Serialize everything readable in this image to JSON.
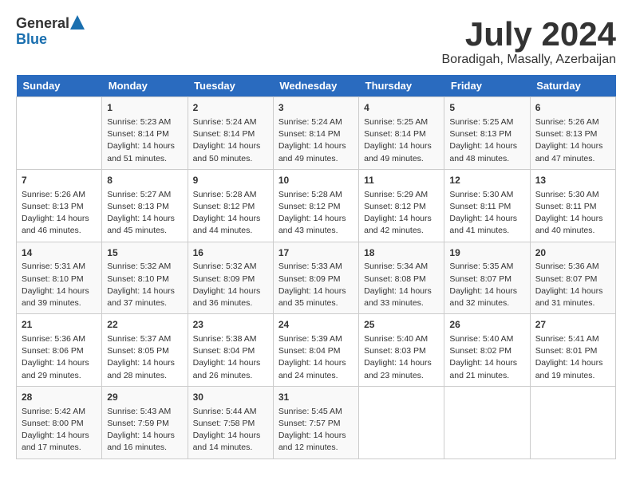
{
  "logo": {
    "general": "General",
    "blue": "Blue"
  },
  "title": "July 2024",
  "subtitle": "Boradigah, Masally, Azerbaijan",
  "days_of_week": [
    "Sunday",
    "Monday",
    "Tuesday",
    "Wednesday",
    "Thursday",
    "Friday",
    "Saturday"
  ],
  "weeks": [
    [
      {
        "day": "",
        "info": ""
      },
      {
        "day": "1",
        "info": "Sunrise: 5:23 AM\nSunset: 8:14 PM\nDaylight: 14 hours\nand 51 minutes."
      },
      {
        "day": "2",
        "info": "Sunrise: 5:24 AM\nSunset: 8:14 PM\nDaylight: 14 hours\nand 50 minutes."
      },
      {
        "day": "3",
        "info": "Sunrise: 5:24 AM\nSunset: 8:14 PM\nDaylight: 14 hours\nand 49 minutes."
      },
      {
        "day": "4",
        "info": "Sunrise: 5:25 AM\nSunset: 8:14 PM\nDaylight: 14 hours\nand 49 minutes."
      },
      {
        "day": "5",
        "info": "Sunrise: 5:25 AM\nSunset: 8:13 PM\nDaylight: 14 hours\nand 48 minutes."
      },
      {
        "day": "6",
        "info": "Sunrise: 5:26 AM\nSunset: 8:13 PM\nDaylight: 14 hours\nand 47 minutes."
      }
    ],
    [
      {
        "day": "7",
        "info": "Sunrise: 5:26 AM\nSunset: 8:13 PM\nDaylight: 14 hours\nand 46 minutes."
      },
      {
        "day": "8",
        "info": "Sunrise: 5:27 AM\nSunset: 8:13 PM\nDaylight: 14 hours\nand 45 minutes."
      },
      {
        "day": "9",
        "info": "Sunrise: 5:28 AM\nSunset: 8:12 PM\nDaylight: 14 hours\nand 44 minutes."
      },
      {
        "day": "10",
        "info": "Sunrise: 5:28 AM\nSunset: 8:12 PM\nDaylight: 14 hours\nand 43 minutes."
      },
      {
        "day": "11",
        "info": "Sunrise: 5:29 AM\nSunset: 8:12 PM\nDaylight: 14 hours\nand 42 minutes."
      },
      {
        "day": "12",
        "info": "Sunrise: 5:30 AM\nSunset: 8:11 PM\nDaylight: 14 hours\nand 41 minutes."
      },
      {
        "day": "13",
        "info": "Sunrise: 5:30 AM\nSunset: 8:11 PM\nDaylight: 14 hours\nand 40 minutes."
      }
    ],
    [
      {
        "day": "14",
        "info": "Sunrise: 5:31 AM\nSunset: 8:10 PM\nDaylight: 14 hours\nand 39 minutes."
      },
      {
        "day": "15",
        "info": "Sunrise: 5:32 AM\nSunset: 8:10 PM\nDaylight: 14 hours\nand 37 minutes."
      },
      {
        "day": "16",
        "info": "Sunrise: 5:32 AM\nSunset: 8:09 PM\nDaylight: 14 hours\nand 36 minutes."
      },
      {
        "day": "17",
        "info": "Sunrise: 5:33 AM\nSunset: 8:09 PM\nDaylight: 14 hours\nand 35 minutes."
      },
      {
        "day": "18",
        "info": "Sunrise: 5:34 AM\nSunset: 8:08 PM\nDaylight: 14 hours\nand 33 minutes."
      },
      {
        "day": "19",
        "info": "Sunrise: 5:35 AM\nSunset: 8:07 PM\nDaylight: 14 hours\nand 32 minutes."
      },
      {
        "day": "20",
        "info": "Sunrise: 5:36 AM\nSunset: 8:07 PM\nDaylight: 14 hours\nand 31 minutes."
      }
    ],
    [
      {
        "day": "21",
        "info": "Sunrise: 5:36 AM\nSunset: 8:06 PM\nDaylight: 14 hours\nand 29 minutes."
      },
      {
        "day": "22",
        "info": "Sunrise: 5:37 AM\nSunset: 8:05 PM\nDaylight: 14 hours\nand 28 minutes."
      },
      {
        "day": "23",
        "info": "Sunrise: 5:38 AM\nSunset: 8:04 PM\nDaylight: 14 hours\nand 26 minutes."
      },
      {
        "day": "24",
        "info": "Sunrise: 5:39 AM\nSunset: 8:04 PM\nDaylight: 14 hours\nand 24 minutes."
      },
      {
        "day": "25",
        "info": "Sunrise: 5:40 AM\nSunset: 8:03 PM\nDaylight: 14 hours\nand 23 minutes."
      },
      {
        "day": "26",
        "info": "Sunrise: 5:40 AM\nSunset: 8:02 PM\nDaylight: 14 hours\nand 21 minutes."
      },
      {
        "day": "27",
        "info": "Sunrise: 5:41 AM\nSunset: 8:01 PM\nDaylight: 14 hours\nand 19 minutes."
      }
    ],
    [
      {
        "day": "28",
        "info": "Sunrise: 5:42 AM\nSunset: 8:00 PM\nDaylight: 14 hours\nand 17 minutes."
      },
      {
        "day": "29",
        "info": "Sunrise: 5:43 AM\nSunset: 7:59 PM\nDaylight: 14 hours\nand 16 minutes."
      },
      {
        "day": "30",
        "info": "Sunrise: 5:44 AM\nSunset: 7:58 PM\nDaylight: 14 hours\nand 14 minutes."
      },
      {
        "day": "31",
        "info": "Sunrise: 5:45 AM\nSunset: 7:57 PM\nDaylight: 14 hours\nand 12 minutes."
      },
      {
        "day": "",
        "info": ""
      },
      {
        "day": "",
        "info": ""
      },
      {
        "day": "",
        "info": ""
      }
    ]
  ]
}
